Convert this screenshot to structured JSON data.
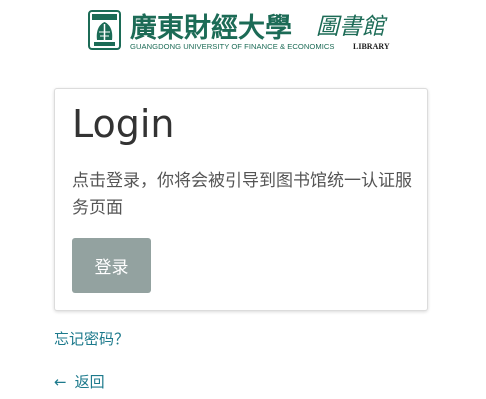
{
  "header": {
    "logo_cn": "廣東財經大學",
    "logo_library_cn": "圖書館",
    "logo_en": "GUANGDONG UNIVERSITY OF FINANCE & ECONOMICS",
    "logo_library_en": "LIBRARY",
    "seal_text": "廣東財經大學",
    "brand_color": "#1c6b56"
  },
  "card": {
    "title": "Login",
    "description": "点击登录，你将会被引导到图书馆统一认证服务页面",
    "login_button": "登录",
    "button_color": "#93a2a0"
  },
  "links": {
    "forgot_password": "忘记密码？",
    "back_arrow": "←",
    "back": "返回",
    "link_color": "#1d7a8c"
  }
}
